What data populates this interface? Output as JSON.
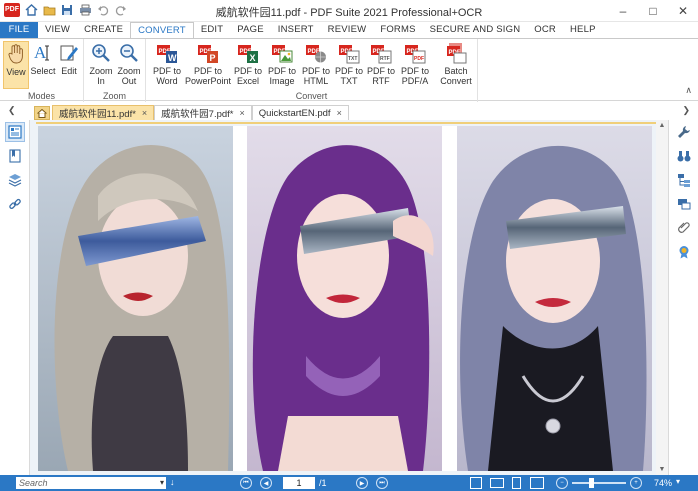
{
  "window": {
    "title": "威航软件园11.pdf  -  PDF Suite 2021 Professional+OCR",
    "logo_text": "PDF"
  },
  "ribbon_tabs": [
    "FILE",
    "VIEW",
    "CREATE",
    "CONVERT",
    "EDIT",
    "PAGE",
    "INSERT",
    "REVIEW",
    "FORMS",
    "SECURE AND SIGN",
    "OCR",
    "HELP"
  ],
  "ribbon": {
    "modes": {
      "name": "Modes",
      "view": "View",
      "select": "Select",
      "edit": "Edit"
    },
    "zoom": {
      "name": "Zoom",
      "zoom_in": "Zoom\nIn",
      "zoom_out": "Zoom\nOut"
    },
    "convert": {
      "name": "Convert",
      "word": "PDF to\nWord",
      "powerpoint": "PDF to\nPowerPoint",
      "excel": "PDF to\nExcel",
      "image": "PDF to\nImage",
      "html": "PDF to\nHTML",
      "txt": "PDF to\nTXT",
      "rtf": "PDF to\nRTF",
      "pdfa": "PDF to\nPDF/A",
      "batch": "Batch\nConvert"
    }
  },
  "doc_tabs": [
    {
      "label": "威航软件园11.pdf*",
      "close": "×"
    },
    {
      "label": "威航软件园7.pdf*",
      "close": "×"
    },
    {
      "label": "QuickstartEN.pdf",
      "close": "×"
    }
  ],
  "status": {
    "search_placeholder": "Search",
    "page_current": "1",
    "page_total": "/1",
    "zoom_level": "74%"
  },
  "colors": {
    "accent": "#2b78c5",
    "active_tab": "#fbe3a8"
  }
}
